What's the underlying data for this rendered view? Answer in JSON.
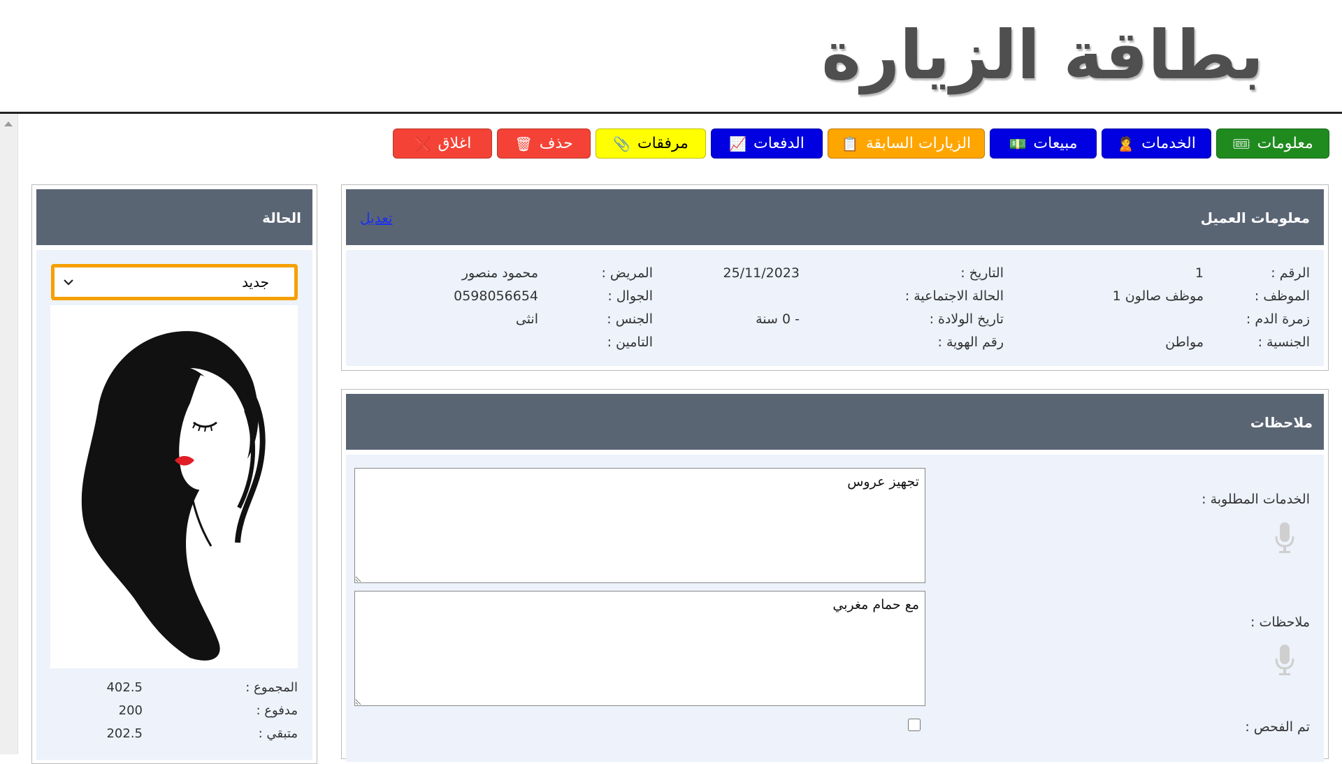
{
  "page": {
    "title": "بطاقة الزيارة"
  },
  "toolbar": {
    "buttons": [
      {
        "label": "معلومات",
        "icon": "🎟",
        "bg": "#1f8b1f",
        "fg": "#ffffff"
      },
      {
        "label": "الخدمات",
        "icon": "🙎",
        "bg": "#0000e0",
        "fg": "#ffffff"
      },
      {
        "label": "مبيعات",
        "icon": "💵",
        "bg": "#0000e0",
        "fg": "#ffffff"
      },
      {
        "label": "الزيارات السابقة",
        "icon": "📋",
        "bg": "#ffa500",
        "fg": "#ffffff"
      },
      {
        "label": "الدفعات",
        "icon": "📈",
        "bg": "#0000e0",
        "fg": "#ffffff"
      },
      {
        "label": "مرفقات",
        "icon": "📎",
        "bg": "#ffff00",
        "fg": "#000000"
      },
      {
        "label": "حذف",
        "icon": "🗑",
        "bg": "#f44336",
        "fg": "#ffffff"
      },
      {
        "label": "اغلاق",
        "icon": "❌",
        "bg": "#f44336",
        "fg": "#ffffff"
      }
    ]
  },
  "client_info": {
    "header": "معلومات العميل",
    "edit_link": "تعديل",
    "fields": {
      "number_label": "الرقم :",
      "number_value": "1",
      "date_label": "التاريخ :",
      "date_value": "25/11/2023",
      "patient_label": "المريض :",
      "patient_value": "محمود منصور",
      "employee_label": "الموظف :",
      "employee_value": "موظف صالون 1",
      "marital_label": "الحالة الاجتماعية :",
      "marital_value": "",
      "mobile_label": "الجوال :",
      "mobile_value": "0598056654",
      "blood_label": "زمرة الدم :",
      "blood_value": "",
      "dob_label": "تاريخ الولادة :",
      "dob_value": "- 0 سنة",
      "gender_label": "الجنس :",
      "gender_value": "انثى",
      "nationality_label": "الجنسية :",
      "nationality_value": "مواطن",
      "id_label": "رقم الهوية :",
      "id_value": "",
      "insurance_label": "التامين :",
      "insurance_value": ""
    }
  },
  "notes": {
    "header": "ملاحظات",
    "services_label": "الخدمات المطلوبة :",
    "services_value": "تجهيز عروس",
    "notes_label": "ملاحظات :",
    "notes_value": "مع حمام مغربي",
    "checked_label": "تم الفحص :",
    "checked": false
  },
  "status": {
    "header": "الحالة",
    "selected": "جديد",
    "portrait_icon": "woman-portrait-illustration",
    "total_label": "المجموع :",
    "total_value": "402.5",
    "paid_label": "مدفوع :",
    "paid_value": "200",
    "remaining_label": "متبقي :",
    "remaining_value": "202.5"
  },
  "colors": {
    "panel_header": "#5a6574",
    "panel_body": "#edf2fb",
    "status_border": "#f5a000",
    "link": "#1a2ff0"
  }
}
